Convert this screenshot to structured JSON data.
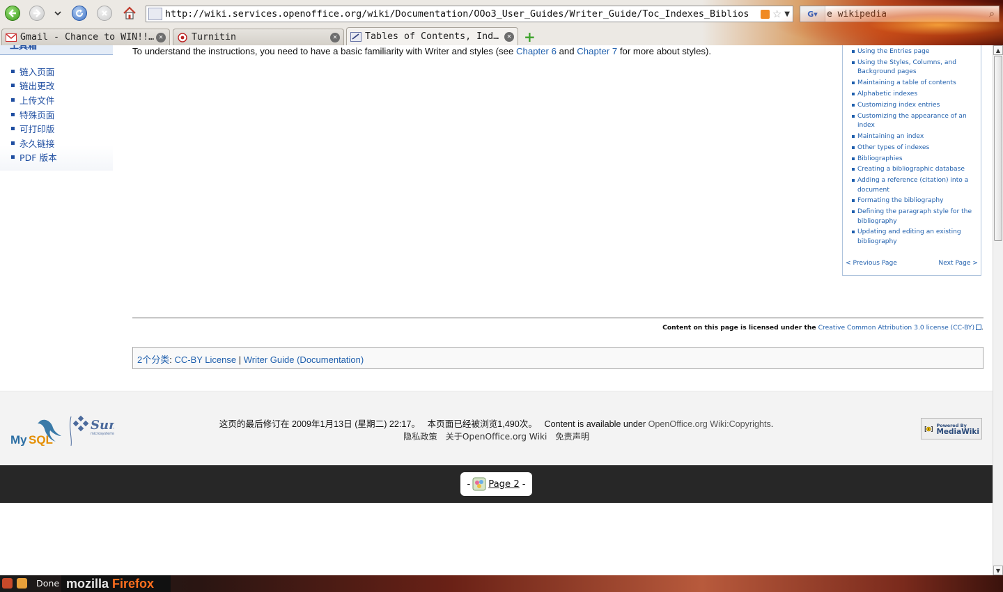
{
  "browser": {
    "url": "http://wiki.services.openoffice.org/wiki/Documentation/OOo3_User_Guides/Writer_Guide/Toc_Indexes_Biblios",
    "search_text": "e wikipedia",
    "search_engine_icon": "google-icon",
    "tabs": [
      {
        "label": "Gmail - Chance to WIN!!…",
        "icon": "gmail-icon",
        "active": false
      },
      {
        "label": "Turnitin",
        "icon": "turnitin-icon",
        "active": false
      },
      {
        "label": "Tables of Contents, Ind…",
        "icon": "wiki-icon",
        "active": true
      }
    ],
    "new_tab": "+",
    "accent": "#3ca22a"
  },
  "sidebar": {
    "heading": "工具箱",
    "items": [
      {
        "label": "链入页面"
      },
      {
        "label": "链出更改"
      },
      {
        "label": "上传文件"
      },
      {
        "label": "特殊页面"
      },
      {
        "label": "可打印版"
      },
      {
        "label": "永久链接"
      },
      {
        "label": "PDF 版本"
      }
    ]
  },
  "content": {
    "intro_prefix": "To understand the instructions, you need to have a basic familiarity with Writer and styles (see",
    "chapter6": "Chapter 6",
    "and": "and",
    "chapter7": "Chapter 7",
    "intro_suffix": "for more about styles)."
  },
  "toc": {
    "items": [
      "Using the Entries page",
      "Using the Styles, Columns, and Background pages",
      "Maintaining a table of contents",
      "Alphabetic indexes",
      "Customizing index entries",
      "Customizing the appearance of an index",
      "Maintaining an index",
      "Other types of indexes",
      "Bibliographies",
      "Creating a bibliographic database",
      "Adding a reference (citation) into a document",
      "Formating the bibliography",
      "Defining the paragraph style for the bibliography",
      "Updating and editing an existing bibliography"
    ],
    "prev_page": "< Previous Page",
    "next_page": "Next Page >"
  },
  "license": {
    "prefix": "Content on this page is licensed under the",
    "link": "Creative Common Attribution 3.0 license (CC-BY)",
    "suffix": "."
  },
  "categories": {
    "label": "2个分类",
    "colon": ":",
    "items": [
      "CC-BY License",
      "Writer Guide (Documentation)"
    ],
    "separator": "|"
  },
  "footer": {
    "last_modified": "这页的最后修订在 2009年1月13日 (星期二) 22:17。",
    "views": "本页面已经被浏览1,490次。",
    "available_prefix": "Content is available under",
    "available_link": "OpenOffice.org Wiki:Copyrights",
    "available_suffix": ".",
    "links": [
      "隐私政策",
      "关于OpenOffice.org Wiki",
      "免责声明"
    ],
    "mysql": "MySQL",
    "sun": "Sun",
    "sun_sub": "microsystems",
    "mediawiki_top": "Powered By",
    "mediawiki_bottom": "MediaWiki"
  },
  "page_pill": {
    "dash_left": "-",
    "label": "Page 2",
    "dash_right": "-"
  },
  "status": {
    "text": "Done",
    "brand_mozilla": "mozilla",
    "brand_firefox": "Firefox"
  }
}
